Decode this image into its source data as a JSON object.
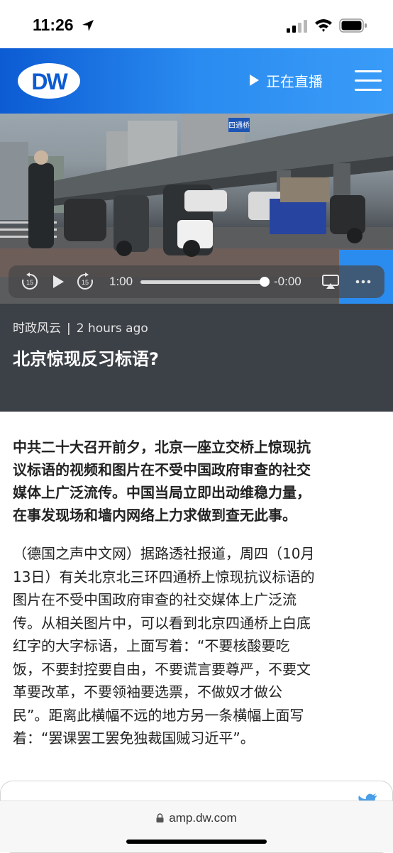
{
  "status_bar": {
    "time": "11:26"
  },
  "header": {
    "logo_text": "DW",
    "live_label": "正在直播"
  },
  "video": {
    "sign_text": "四通桥",
    "player": {
      "rewind_seconds": "15",
      "forward_seconds": "15",
      "elapsed": "1:00",
      "remaining": "-0:00",
      "progress": 1.0
    }
  },
  "article": {
    "category": "时政风云",
    "separator": "|",
    "time_ago": "2 hours ago",
    "title": "北京惊现反习标语?",
    "lead_lines": [
      "中共二十大召开前夕，北京一座立交桥上惊现抗",
      "议标语的视频和图片在不受中国政府审查的社交",
      "媒体上广泛流传。中国当局立即出动维稳力量，",
      "在事发现场和墙内网络上力求做到查无此事。"
    ],
    "body_lines": [
      "（德国之声中文网）据路透社报道，周四（10月",
      "13日）有关北京北三环四通桥上惊现抗议标语的",
      "图片在不受中国政府审查的社交媒体上广泛流",
      "传。从相关图片中，可以看到北京四通桥上白底",
      "红字的大字标语，上面写着：“不要核酸要吃",
      "饭，不要封控要自由，不要谎言要尊严，不要文",
      "革要改革，不要领袖要选票，不做奴才做公",
      "民”。距离此横幅不远的地方另一条横幅上面写",
      "着：“罢课罢工罢免独裁国贼习近平”。"
    ]
  },
  "browser": {
    "url": "amp.dw.com"
  },
  "colors": {
    "header_blue": "#1f77e8",
    "article_head_bg": "#3c4047"
  }
}
